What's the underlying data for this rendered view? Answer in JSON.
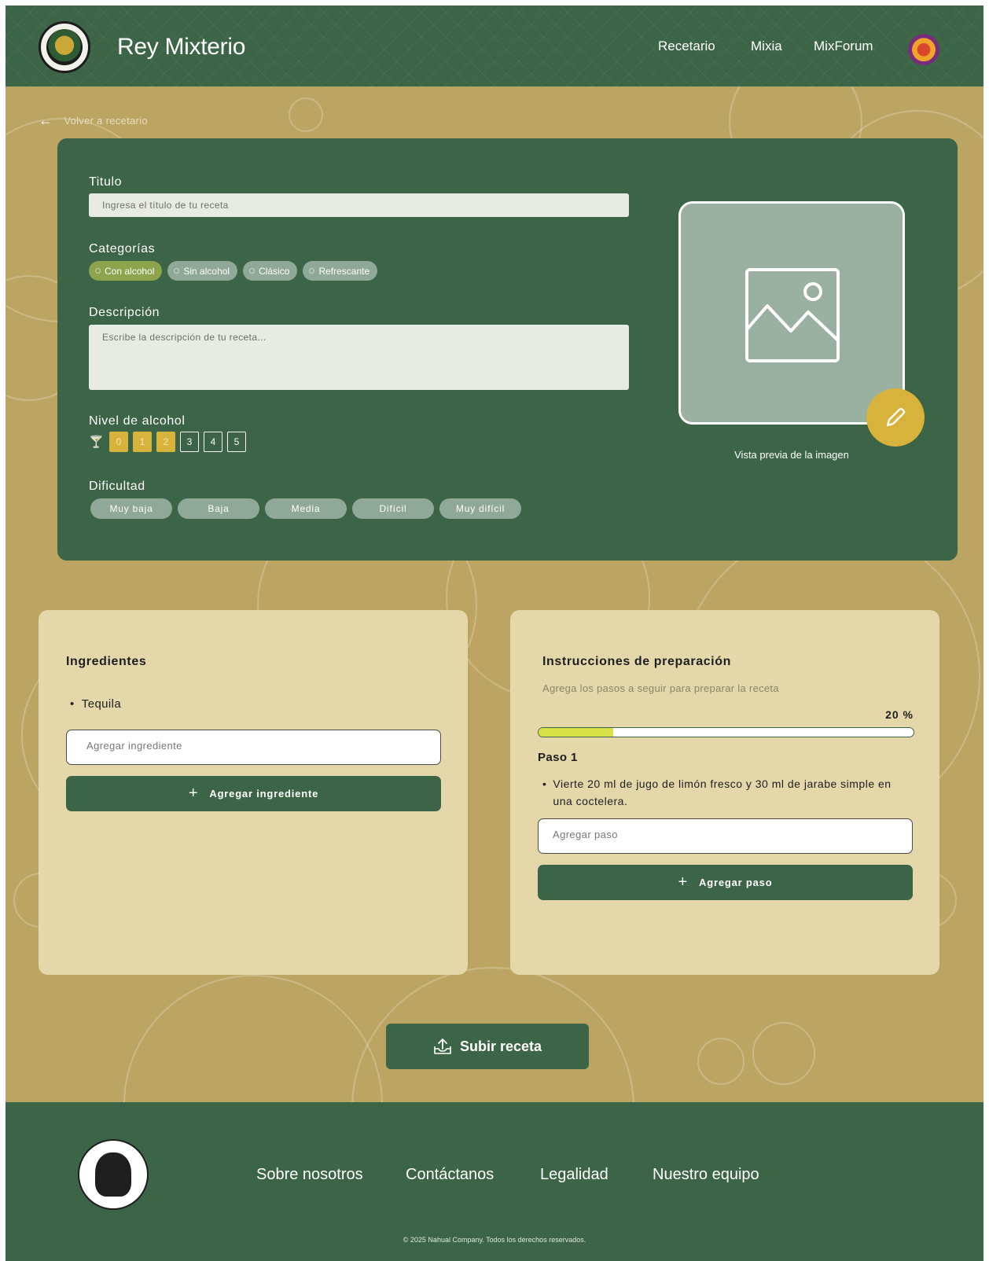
{
  "header": {
    "brand": "Rey Mixterio",
    "nav": [
      "Recetario",
      "Mixia",
      "MixForum"
    ]
  },
  "back_link": "Volver a recetario",
  "form": {
    "title_label": "Titulo",
    "title_placeholder": "Ingresa el título de tu receta",
    "categories_label": "Categorías",
    "categories": [
      {
        "label": "Con alcohol",
        "selected": true
      },
      {
        "label": "Sin alcohol",
        "selected": false
      },
      {
        "label": "Clásico",
        "selected": false
      },
      {
        "label": "Refrescante",
        "selected": false
      }
    ],
    "description_label": "Descripción",
    "description_placeholder": "Escribe la descripción de tu receta...",
    "alcohol_label": "Nivel de alcohol",
    "alcohol_levels": [
      "0",
      "1",
      "2",
      "3",
      "4",
      "5"
    ],
    "alcohol_selected": 2,
    "difficulty_label": "Dificultad",
    "difficulties": [
      "Muy baja",
      "Baja",
      "Media",
      "Difícil",
      "Muy difícil"
    ],
    "image_caption": "Vista previa de la imagen"
  },
  "ingredients": {
    "title": "Ingredientes",
    "items": [
      "Tequila"
    ],
    "input_placeholder": "Agregar ingrediente",
    "add_button": "Agregar ingrediente"
  },
  "instructions": {
    "title": "Instrucciones de preparación",
    "subtitle": "Agrega los pasos a seguir para preparar la receta",
    "progress_label": "20 %",
    "progress_fraction": 0.2,
    "step_title": "Paso 1",
    "step_text": "Vierte 20 ml de jugo de limón fresco y 30 ml de jarabe simple en una coctelera.",
    "input_placeholder": "Agregar paso",
    "add_button": "Agregar paso"
  },
  "submit_button": "Subir receta",
  "footer": {
    "links": [
      "Sobre nosotros",
      "Contáctanos",
      "Legalidad",
      "Nuestro equipo"
    ],
    "copyright": "© 2025 Nahual Company. Todos los derechos reservados."
  },
  "colors": {
    "primary_green": "#3c6446",
    "background_gold": "#bca563",
    "accent_yellow": "#d7b33b",
    "panel_cream": "#e4d8ab",
    "progress_fill": "#d8e048"
  },
  "icons": [
    "back-arrow-icon",
    "image-placeholder-icon",
    "pencil-icon",
    "plus-icon",
    "upload-icon",
    "glass-icon"
  ]
}
